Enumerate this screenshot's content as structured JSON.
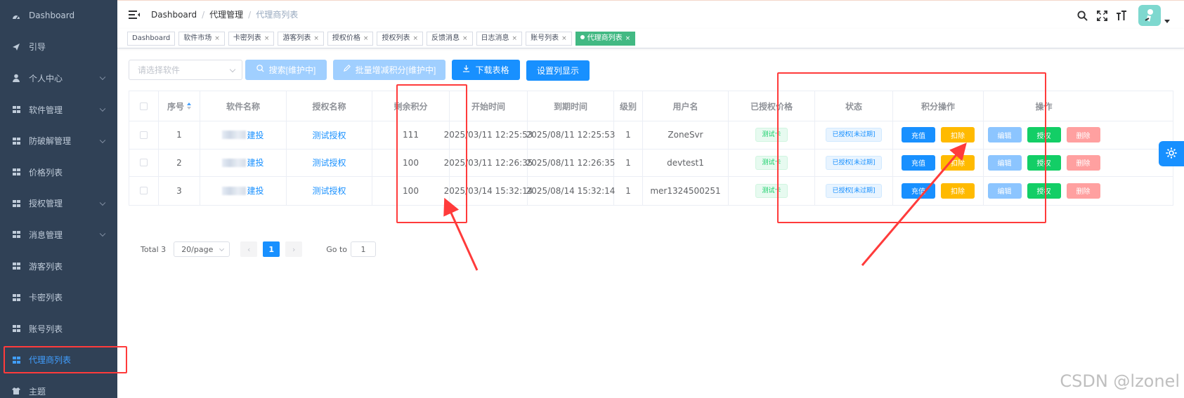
{
  "sidebar": {
    "items": [
      {
        "label": "Dashboard",
        "icon": "dashboard-icon",
        "has_sub": false
      },
      {
        "label": "引导",
        "icon": "send-icon",
        "has_sub": false
      },
      {
        "label": "个人中心",
        "icon": "user-icon",
        "has_sub": true
      },
      {
        "label": "软件管理",
        "icon": "grid-icon",
        "has_sub": true
      },
      {
        "label": "防破解管理",
        "icon": "grid-icon",
        "has_sub": true
      },
      {
        "label": "价格列表",
        "icon": "grid-icon",
        "has_sub": false
      },
      {
        "label": "授权管理",
        "icon": "grid-icon",
        "has_sub": true
      },
      {
        "label": "消息管理",
        "icon": "grid-icon",
        "has_sub": true
      },
      {
        "label": "游客列表",
        "icon": "grid-icon",
        "has_sub": false
      },
      {
        "label": "卡密列表",
        "icon": "grid-icon",
        "has_sub": false
      },
      {
        "label": "账号列表",
        "icon": "grid-icon",
        "has_sub": false
      },
      {
        "label": "代理商列表",
        "icon": "grid-icon",
        "has_sub": false,
        "active": true
      },
      {
        "label": "主题",
        "icon": "shirt-icon",
        "has_sub": false
      }
    ]
  },
  "breadcrumb": [
    "Dashboard",
    "代理管理",
    "代理商列表"
  ],
  "tags": [
    {
      "label": "Dashboard",
      "closable": false
    },
    {
      "label": "软件市场",
      "closable": true
    },
    {
      "label": "卡密列表",
      "closable": true
    },
    {
      "label": "游客列表",
      "closable": true
    },
    {
      "label": "授权价格",
      "closable": true
    },
    {
      "label": "授权列表",
      "closable": true
    },
    {
      "label": "反馈消息",
      "closable": true
    },
    {
      "label": "日志消息",
      "closable": true
    },
    {
      "label": "账号列表",
      "closable": true
    },
    {
      "label": "代理商列表",
      "closable": true,
      "active": true
    }
  ],
  "toolbar": {
    "select_placeholder": "请选择软件",
    "search_label": "搜索[维护中]",
    "batch_label": "批量增减积分[维护中]",
    "download_label": "下载表格",
    "columns_label": "设置列显示"
  },
  "table": {
    "headers": [
      "序号",
      "软件名称",
      "授权名称",
      "剩余积分",
      "开始时间",
      "到期时间",
      "级别",
      "用户名",
      "已授权价格",
      "状态",
      "积分操作",
      "操作"
    ],
    "rows": [
      {
        "index": "1",
        "software_suffix": "建投",
        "auth": "测试授权",
        "points": "111",
        "start": "2025/03/11 12:25:53",
        "end": "2025/08/11 12:25:53",
        "level": "1",
        "username": "ZoneSvr",
        "price_tag": "测试卡",
        "status": "已授权[未过期]"
      },
      {
        "index": "2",
        "software_suffix": "建投",
        "auth": "测试授权",
        "points": "100",
        "start": "2025/03/11 12:26:35",
        "end": "2025/08/11 12:26:35",
        "level": "1",
        "username": "devtest1",
        "price_tag": "测试卡",
        "status": "已授权[未过期]"
      },
      {
        "index": "3",
        "software_suffix": "建投",
        "auth": "测试授权",
        "points": "100",
        "start": "2025/03/14 15:32:14",
        "end": "2025/08/14 15:32:14",
        "level": "1",
        "username": "mer1324500251",
        "price_tag": "测试卡",
        "status": "已授权[未过期]"
      }
    ],
    "point_actions": [
      "充值",
      "扣除"
    ],
    "row_actions": [
      "编辑",
      "授权",
      "删除"
    ]
  },
  "pagination": {
    "total_label": "Total 3",
    "page_size": "20/page",
    "current_page": "1",
    "goto_label": "Go to",
    "goto_value": "1"
  },
  "watermark": "CSDN @lzonel",
  "colors": {
    "sidebar_bg": "#304156",
    "primary": "#1890ff",
    "active_tag": "#42b983",
    "annotation": "#ff3b3b"
  }
}
